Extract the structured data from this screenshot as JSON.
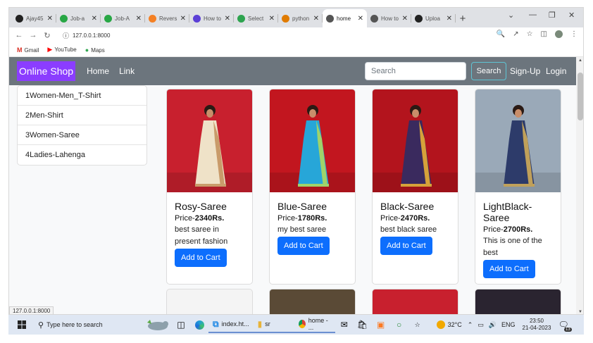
{
  "browser": {
    "tabs": [
      {
        "label": "Ajay45",
        "fav_color": "#222"
      },
      {
        "label": "Job-a",
        "fav_color": "#28a745"
      },
      {
        "label": "Job-A",
        "fav_color": "#28a745"
      },
      {
        "label": "Revers",
        "fav_color": "#f48024"
      },
      {
        "label": "How to",
        "fav_color": "#5b3fd6"
      },
      {
        "label": "Select",
        "fav_color": "#2ea44f"
      },
      {
        "label": "python",
        "fav_color": "#e07b00"
      },
      {
        "label": "home",
        "fav_color": "#555"
      },
      {
        "label": "How to",
        "fav_color": "#555"
      },
      {
        "label": "Uploa",
        "fav_color": "#222"
      }
    ],
    "active_tab": 7,
    "url": "127.0.0.1:8000",
    "bookmarks": [
      "Gmail",
      "YouTube",
      "Maps"
    ],
    "status_text": "127.0.0.1:8000"
  },
  "navbar": {
    "brand": "Online Shop",
    "links": [
      "Home",
      "Link"
    ],
    "search_placeholder": "Search",
    "search_button": "Search",
    "signup": "Sign-Up",
    "login": "Login"
  },
  "categories": [
    "1Women-Men_T-Shirt",
    "2Men-Shirt",
    "3Women-Saree",
    "4Ladies-Lahenga"
  ],
  "products": [
    {
      "name": "Rosy-Saree",
      "price_label": "Price-",
      "price": "2340Rs.",
      "desc": "best saree in present fashion",
      "button": "Add to Cart",
      "bg": "#c8202e",
      "saree": "#efe2c8",
      "border": "#c99b6a"
    },
    {
      "name": "Blue-Saree",
      "price_label": "Price-",
      "price": "1780Rs.",
      "desc": "my best saree",
      "button": "Add to Cart",
      "bg": "#c2161f",
      "saree": "#27a6d8",
      "border": "#9fd36a"
    },
    {
      "name": "Black-Saree",
      "price_label": "Price-",
      "price": "2470Rs.",
      "desc": "best black saree",
      "button": "Add to Cart",
      "bg": "#b3141d",
      "saree": "#3a2a5e",
      "border": "#d6a23a"
    },
    {
      "name": "LightBlack-Saree",
      "price_label": "Price-",
      "price": "2700Rs.",
      "desc": "This is one of the best",
      "button": "Add to Cart",
      "bg": "#9aa9b8",
      "saree": "#2d3b6a",
      "border": "#c0a05a"
    }
  ],
  "taskbar": {
    "search_placeholder": "Type here to search",
    "items": [
      "index.ht...",
      "sr",
      "home - ..."
    ],
    "weather": "32°C",
    "lang": "ENG",
    "time": "23:50",
    "date": "21-04-2023",
    "notif": "13"
  }
}
